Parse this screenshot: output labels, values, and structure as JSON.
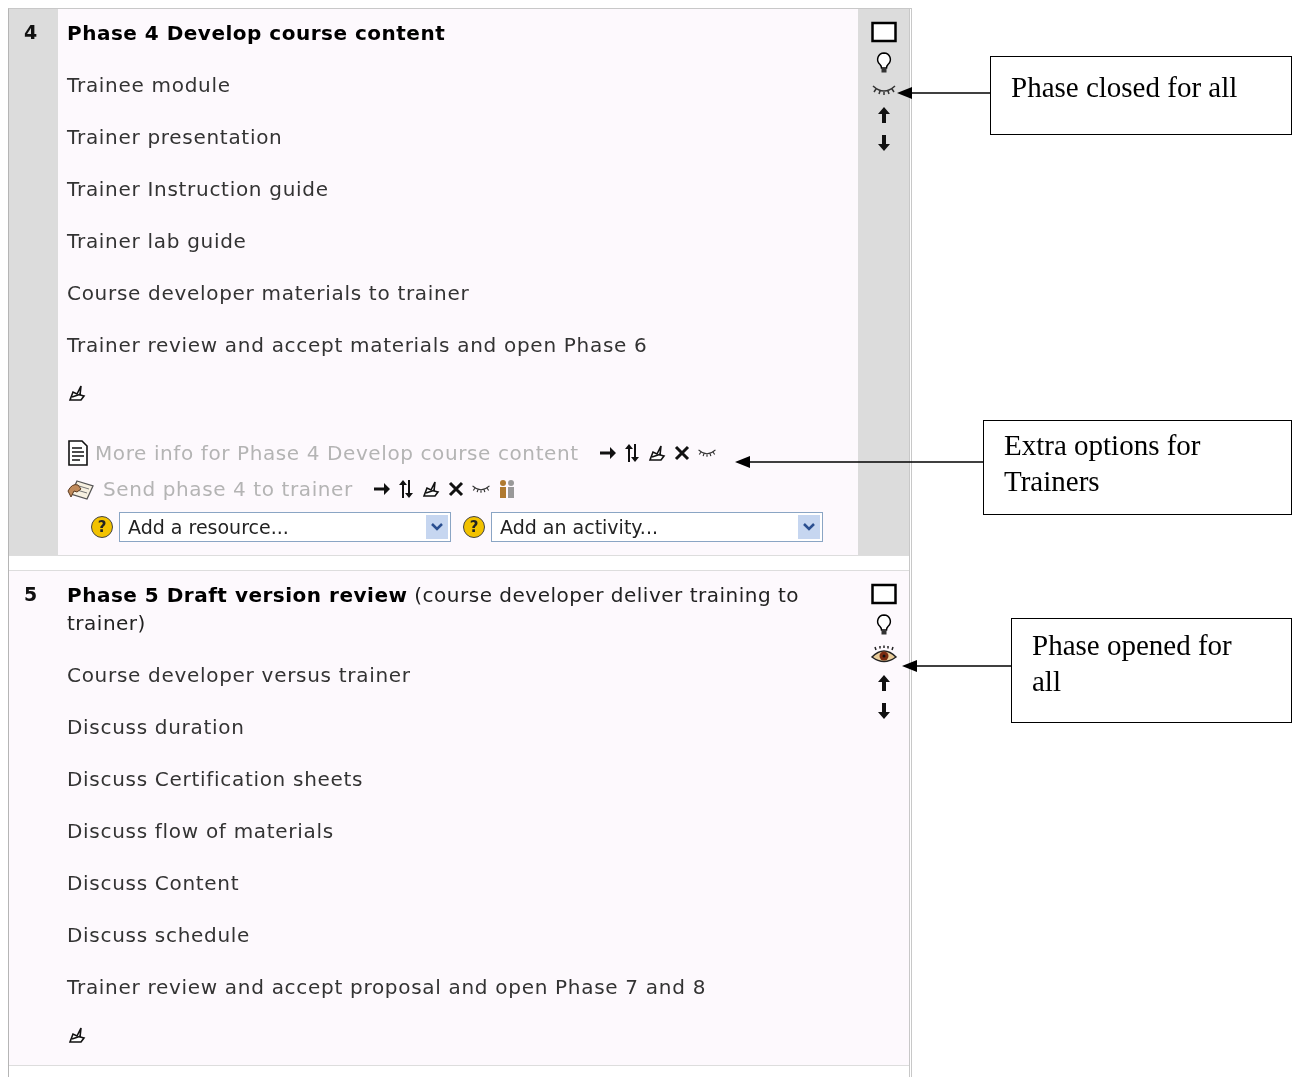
{
  "sections": [
    {
      "number": "4",
      "title": "Phase 4 Develop course content",
      "current": true,
      "visible": false,
      "items": [
        "Trainee module",
        "Trainer presentation",
        "Trainer Instruction guide",
        "Trainer lab guide",
        "Course developer materials to trainer",
        "Trainer review and accept materials and open Phase 6"
      ],
      "activities": [
        {
          "kind": "resource",
          "label": "More info for Phase 4 Develop course content",
          "hidden": true,
          "group_mode": false
        },
        {
          "kind": "assignment",
          "label": "Send phase 4 to trainer",
          "hidden": true,
          "group_mode": true
        }
      ],
      "add_menus": [
        {
          "help": "?",
          "value": "Add a resource..."
        },
        {
          "help": "?",
          "value": "Add an activity..."
        }
      ]
    },
    {
      "number": "5",
      "title": "Phase 5 Draft version review",
      "subtitle": "(course developer deliver training to trainer)",
      "current": false,
      "visible": true,
      "items": [
        "Course developer versus trainer",
        "Discuss duration",
        "Discuss Certification sheets",
        "Discuss flow of materials",
        "Discuss Content",
        "Discuss schedule",
        "Trainer review and accept proposal and open Phase 7 and 8"
      ]
    }
  ],
  "callouts": [
    {
      "text": "Phase closed for all"
    },
    {
      "text": "Extra options for Trainers"
    },
    {
      "text": "Phase opened for all"
    }
  ]
}
